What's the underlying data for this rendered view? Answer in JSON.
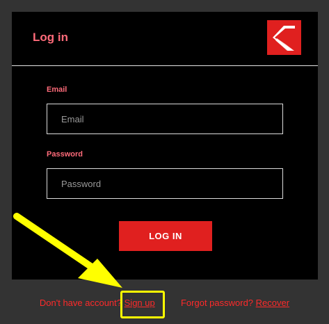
{
  "header": {
    "title": "Log in",
    "logo_icon": "brand-logo-icon"
  },
  "form": {
    "email_label": "Email",
    "email_placeholder": "Email",
    "email_value": "",
    "password_label": "Password",
    "password_placeholder": "Password",
    "password_value": "",
    "login_button": "LOG IN"
  },
  "footer": {
    "signup_prompt": "Don't have account?",
    "signup_link": "Sign up",
    "recover_prompt": "Forgot password?",
    "recover_link": "Recover"
  },
  "colors": {
    "accent": "#e0201f",
    "label": "#ff6b7a",
    "panel_bg": "#000000",
    "page_bg": "#333333",
    "annotation": "#ffff00"
  }
}
